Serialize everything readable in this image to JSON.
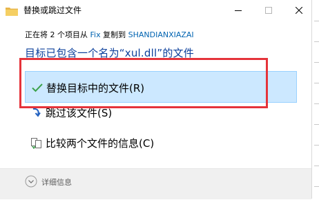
{
  "window": {
    "title": "替换或跳过文件",
    "icon": "folder-icon",
    "minimize_icon": "minimize-icon",
    "maximize_icon": "maximize-icon",
    "close_icon": "close-icon"
  },
  "status": {
    "prefix": "正在将 2 个项目从 ",
    "source": "Fix",
    "middle": " 复制到 ",
    "destination": "SHANDIANXIAZAI"
  },
  "question": "目标已包含一个名为“xul.dll”的文件",
  "options": [
    {
      "label": "替换目标中的文件(R)",
      "icon": "checkmark-icon",
      "selected": true
    },
    {
      "label": "跳过该文件(S)",
      "icon": "skip-arrow-icon",
      "selected": false
    },
    {
      "label": "比较两个文件的信息(C)",
      "icon": "compare-files-icon",
      "selected": false
    }
  ],
  "footer": {
    "details_label": "详细信息",
    "details_icon": "chevron-down-icon"
  },
  "colors": {
    "accent": "#0063b1",
    "question_text": "#0b3f9b",
    "selected_bg": "#cce8ff",
    "selected_border": "#99d1ff",
    "annotation_red": "#e5333a",
    "check_green": "#3aa14a"
  }
}
